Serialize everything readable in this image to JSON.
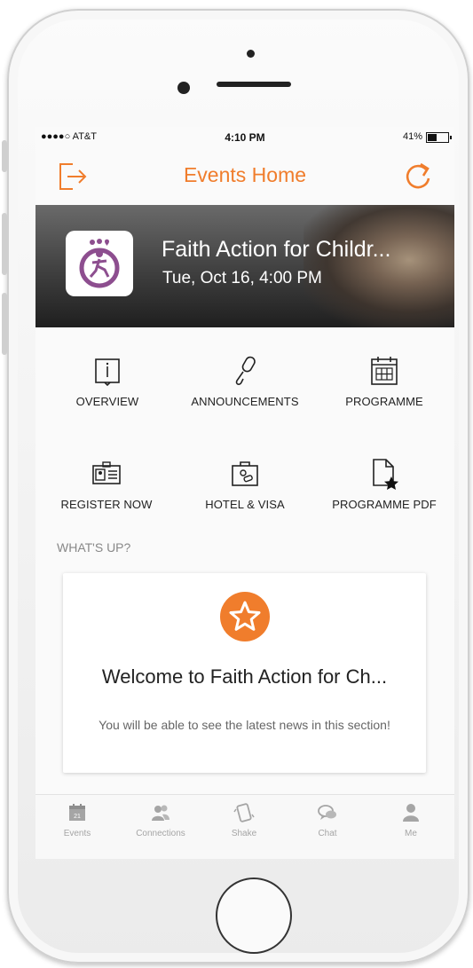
{
  "status_bar": {
    "carrier": "●●●●○ AT&T",
    "time": "4:10 PM",
    "battery": "41%",
    "battery_level": 0.41
  },
  "navbar": {
    "title": "Events Home",
    "left_icon": "exit-icon",
    "right_icon": "refresh-icon",
    "accent_color": "#f07d2c"
  },
  "event": {
    "title": "Faith Action for Childr...",
    "date": "Tue, Oct 16, 4:00 PM"
  },
  "menu": {
    "items": [
      {
        "label": "OVERVIEW",
        "icon": "info-icon"
      },
      {
        "label": "ANNOUNCEMENTS",
        "icon": "microphone-icon"
      },
      {
        "label": "PROGRAMME",
        "icon": "calendar-icon"
      },
      {
        "label": "REGISTER NOW",
        "icon": "id-card-icon"
      },
      {
        "label": "HOTEL & VISA",
        "icon": "passport-icon"
      },
      {
        "label": "PROGRAMME PDF",
        "icon": "pdf-star-icon"
      }
    ]
  },
  "whatsup": {
    "heading": "WHAT'S UP?",
    "card": {
      "title": "Welcome to Faith Action for Ch...",
      "body": "You will be able to see the latest news in this section!",
      "icon": "star-icon"
    }
  },
  "tabbar": {
    "tabs": [
      {
        "label": "Events",
        "icon": "calendar-icon"
      },
      {
        "label": "Connections",
        "icon": "people-icon"
      },
      {
        "label": "Shake",
        "icon": "shake-icon"
      },
      {
        "label": "Chat",
        "icon": "chat-icon"
      },
      {
        "label": "Me",
        "icon": "person-icon"
      }
    ]
  }
}
